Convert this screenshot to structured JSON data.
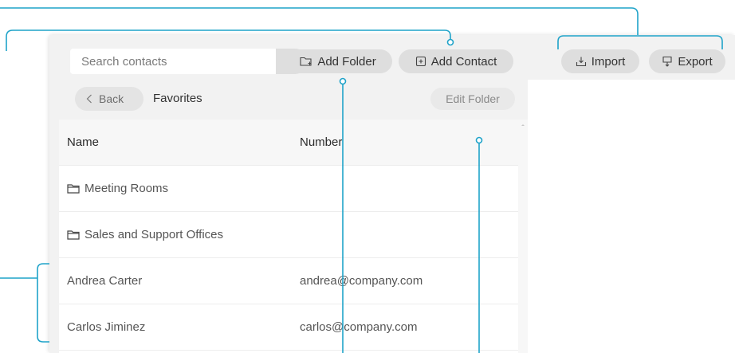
{
  "toolbar": {
    "search_placeholder": "Search contacts",
    "add_folder_label": "Add Folder",
    "add_contact_label": "Add Contact",
    "import_label": "Import",
    "export_label": "Export"
  },
  "subheader": {
    "back_label": "Back",
    "folder_title": "Favorites",
    "edit_folder_label": "Edit Folder"
  },
  "table": {
    "columns": {
      "name": "Name",
      "number": "Number"
    },
    "rows": [
      {
        "name": "Meeting Rooms",
        "number": "",
        "type": "folder"
      },
      {
        "name": "Sales and Support Offices",
        "number": "",
        "type": "folder"
      },
      {
        "name": "Andrea Carter",
        "number": "andrea@company.com",
        "type": "contact"
      },
      {
        "name": "Carlos Jiminez",
        "number": "carlos@company.com",
        "type": "contact"
      }
    ]
  },
  "colors": {
    "callout": "#1fa3c9",
    "button_bg": "#dedede",
    "panel_bg": "#f2f2f2"
  },
  "icons": {
    "clear": "close-icon",
    "add_folder": "folder-plus-icon",
    "add_contact": "contact-plus-icon",
    "import": "import-icon",
    "export": "export-icon",
    "back": "chevron-left-icon",
    "folder": "folder-icon"
  }
}
